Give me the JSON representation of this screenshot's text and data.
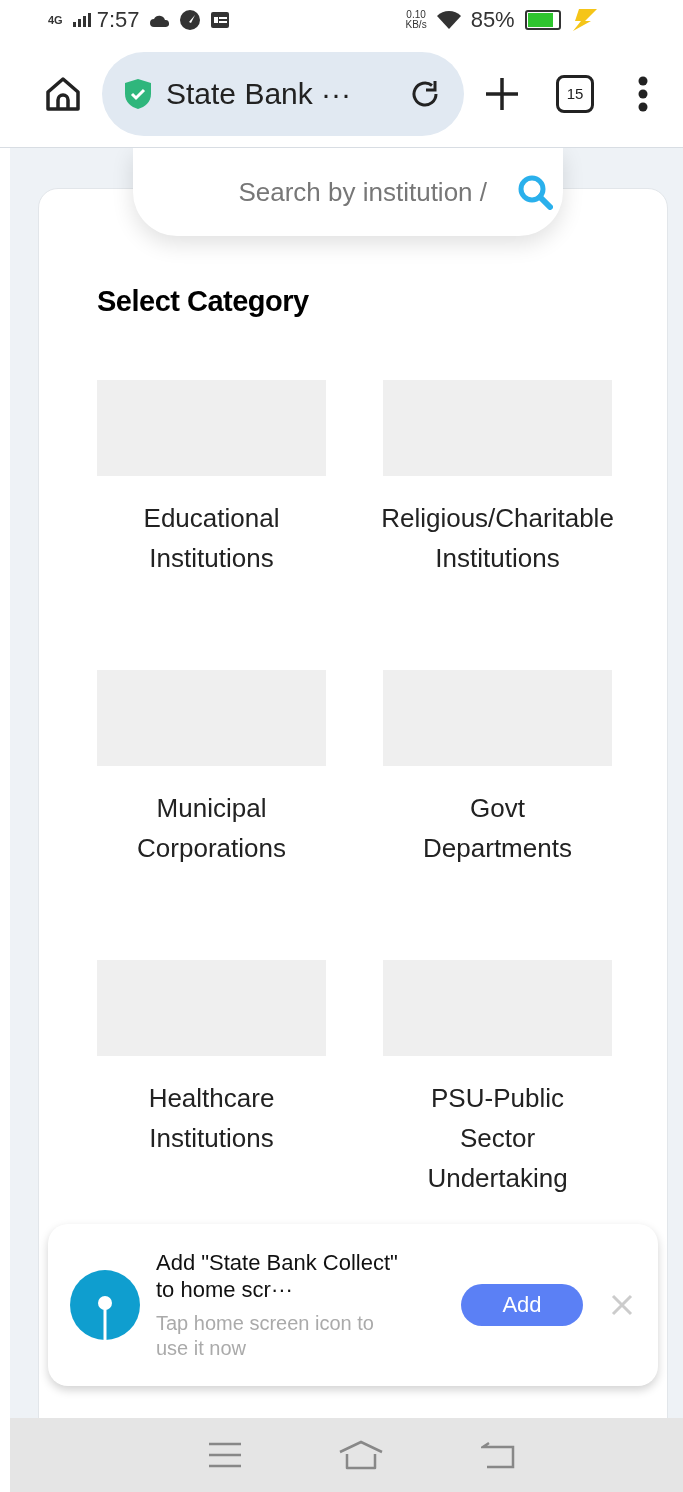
{
  "status_bar": {
    "network": "4G",
    "time": "7:57",
    "speed": "0.10",
    "speed_unit": "KB/s",
    "battery": "85%"
  },
  "browser": {
    "site_title": "State Bank ···",
    "secure": true,
    "tab_count": "15"
  },
  "search": {
    "placeholder": "Search by institution /"
  },
  "heading": "Select Category",
  "categories": [
    {
      "lines": [
        "Educational",
        "Institutions"
      ]
    },
    {
      "lines": [
        "Religious/Charitable",
        "Institutions"
      ]
    },
    {
      "lines": [
        "Municipal",
        "Corporations"
      ]
    },
    {
      "lines": [
        "Govt",
        "Departments"
      ]
    },
    {
      "lines": [
        "Healthcare",
        "Institutions"
      ]
    },
    {
      "lines": [
        "PSU-Public",
        "Sector",
        "Undertaking"
      ]
    }
  ],
  "banner": {
    "title": "Add \"State Bank Collect\" to home scr···",
    "subtitle": "Tap home screen icon to use it now",
    "add_label": "Add"
  }
}
